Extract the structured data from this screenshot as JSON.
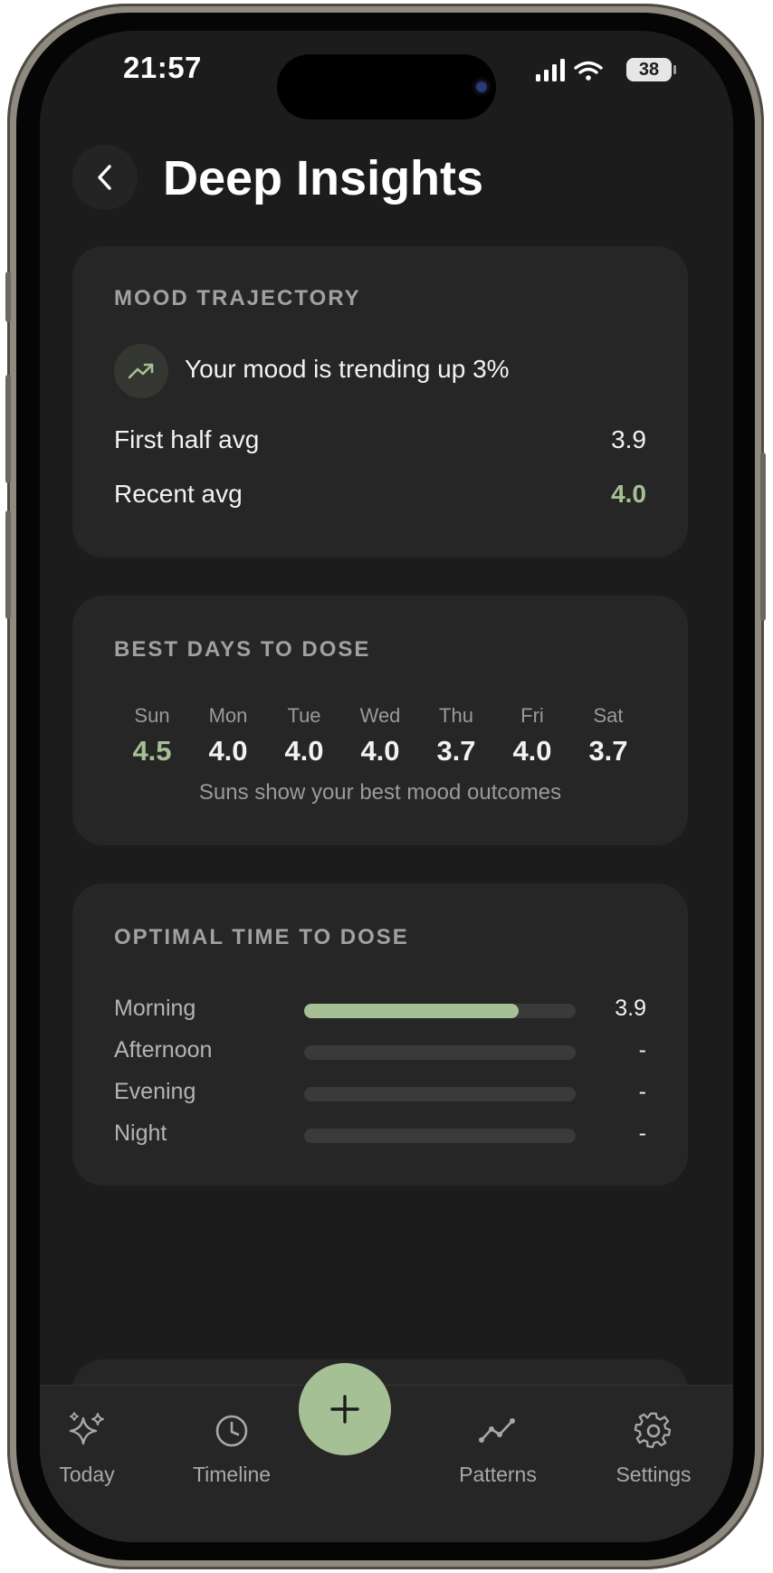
{
  "status_bar": {
    "time": "21:57",
    "battery": "38"
  },
  "header": {
    "title": "Deep Insights"
  },
  "mood_trajectory": {
    "heading": "MOOD TRAJECTORY",
    "trend_text": "Your mood is trending up 3%",
    "rows": [
      {
        "label": "First half avg",
        "value": "3.9"
      },
      {
        "label": "Recent avg",
        "value": "4.0"
      }
    ]
  },
  "best_days": {
    "heading": "BEST DAYS TO DOSE",
    "days": [
      {
        "name": "Sun",
        "value": "4.5"
      },
      {
        "name": "Mon",
        "value": "4.0"
      },
      {
        "name": "Tue",
        "value": "4.0"
      },
      {
        "name": "Wed",
        "value": "4.0"
      },
      {
        "name": "Thu",
        "value": "3.7"
      },
      {
        "name": "Fri",
        "value": "4.0"
      },
      {
        "name": "Sat",
        "value": "3.7"
      }
    ],
    "caption": "Suns show your best mood outcomes"
  },
  "optimal_time": {
    "heading": "OPTIMAL TIME TO DOSE",
    "rows": [
      {
        "label": "Morning",
        "value": "3.9",
        "fill_fraction": 0.79
      },
      {
        "label": "Afternoon",
        "value": "-",
        "fill_fraction": 0
      },
      {
        "label": "Evening",
        "value": "-",
        "fill_fraction": 0
      },
      {
        "label": "Night",
        "value": "-",
        "fill_fraction": 0
      }
    ]
  },
  "tabbar": {
    "today": "Today",
    "timeline": "Timeline",
    "patterns": "Patterns",
    "settings": "Settings"
  },
  "colors": {
    "accent": "#a6c095",
    "background": "#1c1c1c",
    "card": "#262626"
  }
}
